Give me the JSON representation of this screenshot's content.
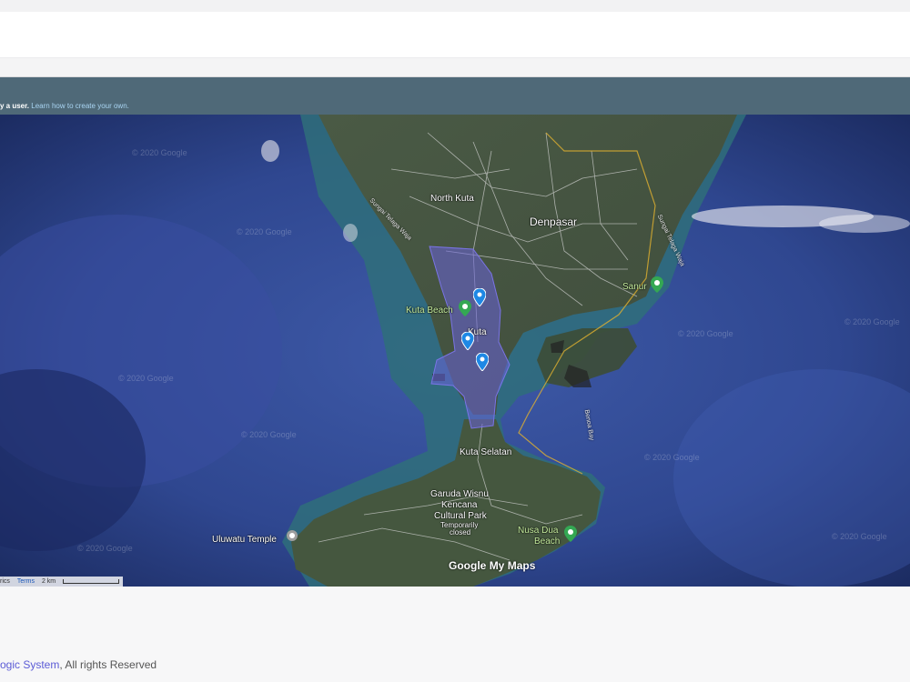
{
  "embed": {
    "notice_text": "y a user.",
    "notice_link": "Learn how to create your own."
  },
  "map": {
    "labels": {
      "north_kuta": "North Kuta",
      "denpasar": "Denpasar",
      "sanur": "Sanur",
      "kuta_beach": "Kuta Beach",
      "kuta": "Kuta",
      "kuta_selatan": "Kuta Selatan",
      "gwk_line1": "Garuda Wisnu",
      "gwk_line2": "Kencana",
      "gwk_line3": "Cultural Park",
      "gwk_status1": "Temporarily",
      "gwk_status2": "closed",
      "uluwatu": "Uluwatu Temple",
      "nusa_dua1": "Nusa Dua",
      "nusa_dua2": "Beach",
      "benoa_bay": "Benoa Bay",
      "sungai_telaga_waja": "Sungai Telaga Waja",
      "sungai_telaga_waja_east": "Sungai Telaga Waja"
    },
    "watermark": "© 2020 Google",
    "brand_google": "Google",
    "brand_mymaps": "My Maps",
    "attribution": "rics",
    "terms": "Terms",
    "scale": "2 km"
  },
  "footer": {
    "system": "ogic System",
    "rights": ", All rights Reserved"
  },
  "colors": {
    "embed_bar": "#4f6978",
    "polygon": "#6a63d8",
    "pin": "#1e88e5",
    "poi": "#34a853",
    "link": "#5b5bd6"
  }
}
